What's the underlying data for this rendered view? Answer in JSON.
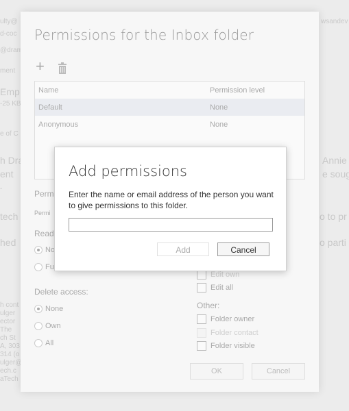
{
  "background": {
    "fragments": [
      "ulty@",
      "d-coc",
      "@dram",
      "ment",
      "Emp",
      "-25 KB",
      "e of C",
      "h Dra",
      "ent",
      "-",
      "tech h",
      "hed",
      "h cont",
      "ulger",
      "ector",
      "The",
      "ch St",
      "A, 303",
      "314 (o",
      "ulger@",
      "ech.c",
      "aTech",
      "wsandev",
      "Annie",
      "e soug",
      "o to pr",
      "o parti"
    ]
  },
  "panel": {
    "title": "Permissions for the Inbox folder",
    "add_icon": "+",
    "delete_icon": "🗑",
    "table": {
      "headers": {
        "name": "Name",
        "level": "Permission level"
      },
      "rows": [
        {
          "name": "Default",
          "level": "None",
          "selected": true
        },
        {
          "name": "Anonymous",
          "level": "None",
          "selected": false
        }
      ]
    },
    "perm_section_label": "Perm",
    "perm_sub_label": "Permi",
    "read_label": "Read",
    "read_options": [
      "No",
      "Fu"
    ],
    "write_options": [
      "Edit own",
      "Edit all"
    ],
    "delete_access_label": "Delete access:",
    "delete_options": [
      "None",
      "Own",
      "All"
    ],
    "other_label": "Other:",
    "other_options": [
      "Folder owner",
      "Folder contact",
      "Folder visible"
    ],
    "ok_label": "OK",
    "cancel_label": "Cancel"
  },
  "modal": {
    "title": "Add permissions",
    "description": "Enter the name or email address of the person you want to give permissions to this folder.",
    "input_value": "",
    "add_label": "Add",
    "cancel_label": "Cancel"
  }
}
